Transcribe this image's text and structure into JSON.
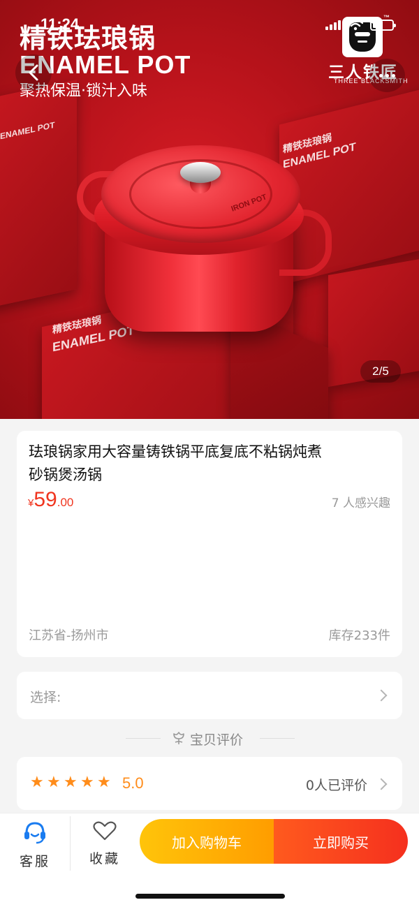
{
  "status_bar": {
    "time": "11:24"
  },
  "hero": {
    "title_cn": "精铁珐琅锅",
    "title_en": "ENAMEL POT",
    "subtitle": "聚热保温·锁汁入味",
    "brand_cn": "三人铁匠",
    "brand_en": "THREE BLACKSMITH",
    "brand_tm": "™",
    "pot_brand": "IRON POT",
    "box_text_cn": "精铁珐琅锅",
    "box_text_en": "ENAMEL POT",
    "page_indicator": "2/5"
  },
  "product": {
    "title": "珐琅锅家用大容量铸铁锅平底复底不粘锅炖煮砂锅煲汤锅",
    "price_symbol": "¥",
    "price_integer": "59",
    "price_decimal": ".00",
    "interest": "7 人感兴趣",
    "location": "江苏省-扬州市",
    "stock": "库存233件"
  },
  "select": {
    "label": "选择:"
  },
  "reviews": {
    "header": "宝贝评价",
    "stars": [
      "★",
      "★",
      "★",
      "★",
      "★"
    ],
    "score": "5.0",
    "count": "0人已评价"
  },
  "bottom_bar": {
    "service_label": "客服",
    "favorite_label": "收藏",
    "add_to_cart": "加入购物车",
    "buy_now": "立即购买"
  },
  "colors": {
    "price": "#f0351f",
    "star": "#ff8c1a",
    "cart_button": "#ffb000",
    "buy_button": "#f5301e",
    "service_icon": "#1a7cf0"
  },
  "icons": {
    "back": "chevron-left-icon",
    "more": "more-dots-icon",
    "service": "headset-icon",
    "favorite": "heart-icon",
    "review": "flower-icon",
    "chevron": "chevron-right-icon"
  }
}
